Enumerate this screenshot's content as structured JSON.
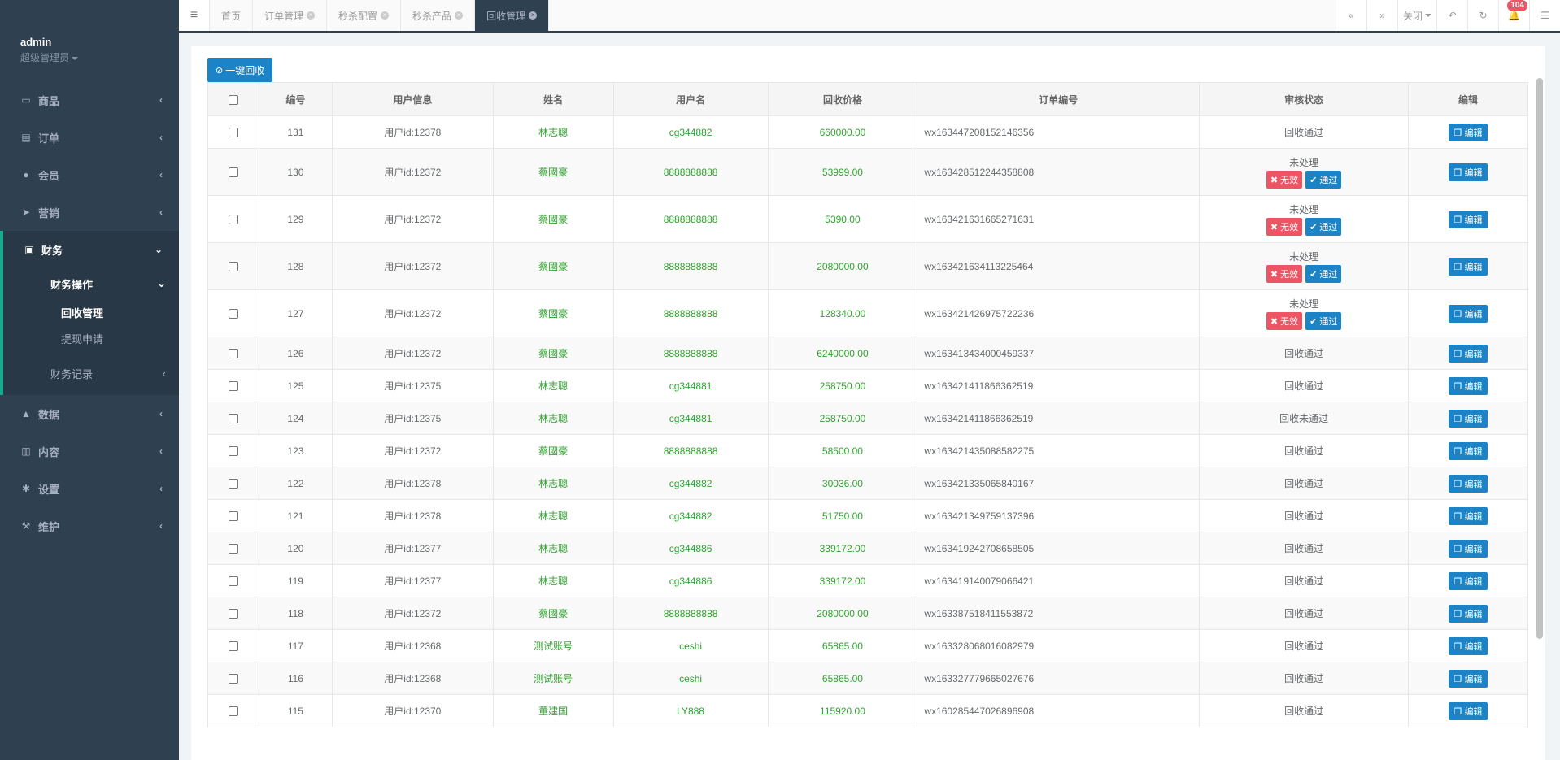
{
  "user": {
    "name": "admin",
    "role": "超级管理员"
  },
  "nav": [
    {
      "label": "商品",
      "icon": "monitor-icon"
    },
    {
      "label": "订单",
      "icon": "document-icon"
    },
    {
      "label": "会员",
      "icon": "user-icon"
    },
    {
      "label": "营销",
      "icon": "send-icon"
    }
  ],
  "nav_active": {
    "label": "财务",
    "icon": "money-icon",
    "sub": {
      "label": "财务操作",
      "items": [
        {
          "label": "回收管理"
        },
        {
          "label": "提现申请"
        }
      ]
    },
    "sub2": {
      "label": "财务记录"
    }
  },
  "nav_after": [
    {
      "label": "数据",
      "icon": "chart-icon"
    },
    {
      "label": "内容",
      "icon": "book-icon"
    },
    {
      "label": "设置",
      "icon": "gear-icon"
    },
    {
      "label": "维护",
      "icon": "wrench-icon"
    }
  ],
  "tabs": [
    {
      "label": "首页",
      "closable": false
    },
    {
      "label": "订单管理",
      "closable": true
    },
    {
      "label": "秒杀配置",
      "closable": true
    },
    {
      "label": "秒杀产品",
      "closable": true
    },
    {
      "label": "回收管理",
      "closable": true,
      "active": true
    }
  ],
  "topbar": {
    "close_label": "关闭",
    "notification_count": "104"
  },
  "toolbar": {
    "one_key_label": "一键回收"
  },
  "table": {
    "headers": [
      "编号",
      "用户信息",
      "姓名",
      "用户名",
      "回收价格",
      "订单编号",
      "审核状态",
      "编辑"
    ],
    "edit_label": "编辑",
    "invalid_label": "无效",
    "pass_label": "通过",
    "rows": [
      {
        "id": "131",
        "user_info": "用户id:12378",
        "name": "林志聰",
        "username": "cg344882",
        "price": "660000.00",
        "order_no": "wx163447208152146356",
        "status": "回收通过",
        "pending": false
      },
      {
        "id": "130",
        "user_info": "用户id:12372",
        "name": "蔡國豪",
        "username": "8888888888",
        "price": "53999.00",
        "order_no": "wx163428512244358808",
        "status": "未处理",
        "pending": true
      },
      {
        "id": "129",
        "user_info": "用户id:12372",
        "name": "蔡國豪",
        "username": "8888888888",
        "price": "5390.00",
        "order_no": "wx163421631665271631",
        "status": "未处理",
        "pending": true
      },
      {
        "id": "128",
        "user_info": "用户id:12372",
        "name": "蔡國豪",
        "username": "8888888888",
        "price": "2080000.00",
        "order_no": "wx163421634113225464",
        "status": "未处理",
        "pending": true
      },
      {
        "id": "127",
        "user_info": "用户id:12372",
        "name": "蔡國豪",
        "username": "8888888888",
        "price": "128340.00",
        "order_no": "wx163421426975722236",
        "status": "未处理",
        "pending": true
      },
      {
        "id": "126",
        "user_info": "用户id:12372",
        "name": "蔡國豪",
        "username": "8888888888",
        "price": "6240000.00",
        "order_no": "wx163413434000459337",
        "status": "回收通过",
        "pending": false
      },
      {
        "id": "125",
        "user_info": "用户id:12375",
        "name": "林志聰",
        "username": "cg344881",
        "price": "258750.00",
        "order_no": "wx163421411866362519",
        "status": "回收通过",
        "pending": false
      },
      {
        "id": "124",
        "user_info": "用户id:12375",
        "name": "林志聰",
        "username": "cg344881",
        "price": "258750.00",
        "order_no": "wx163421411866362519",
        "status": "回收未通过",
        "pending": false
      },
      {
        "id": "123",
        "user_info": "用户id:12372",
        "name": "蔡國豪",
        "username": "8888888888",
        "price": "58500.00",
        "order_no": "wx163421435088582275",
        "status": "回收通过",
        "pending": false
      },
      {
        "id": "122",
        "user_info": "用户id:12378",
        "name": "林志聰",
        "username": "cg344882",
        "price": "30036.00",
        "order_no": "wx163421335065840167",
        "status": "回收通过",
        "pending": false
      },
      {
        "id": "121",
        "user_info": "用户id:12378",
        "name": "林志聰",
        "username": "cg344882",
        "price": "51750.00",
        "order_no": "wx163421349759137396",
        "status": "回收通过",
        "pending": false
      },
      {
        "id": "120",
        "user_info": "用户id:12377",
        "name": "林志聰",
        "username": "cg344886",
        "price": "339172.00",
        "order_no": "wx163419242708658505",
        "status": "回收通过",
        "pending": false
      },
      {
        "id": "119",
        "user_info": "用户id:12377",
        "name": "林志聰",
        "username": "cg344886",
        "price": "339172.00",
        "order_no": "wx163419140079066421",
        "status": "回收通过",
        "pending": false
      },
      {
        "id": "118",
        "user_info": "用户id:12372",
        "name": "蔡國豪",
        "username": "8888888888",
        "price": "2080000.00",
        "order_no": "wx163387518411553872",
        "status": "回收通过",
        "pending": false
      },
      {
        "id": "117",
        "user_info": "用户id:12368",
        "name": "测试账号",
        "username": "ceshi",
        "price": "65865.00",
        "order_no": "wx163328068016082979",
        "status": "回收通过",
        "pending": false
      },
      {
        "id": "116",
        "user_info": "用户id:12368",
        "name": "测试账号",
        "username": "ceshi",
        "price": "65865.00",
        "order_no": "wx163327779665027676",
        "status": "回收通过",
        "pending": false
      },
      {
        "id": "115",
        "user_info": "用户id:12370",
        "name": "董建国",
        "username": "LY888",
        "price": "115920.00",
        "order_no": "wx160285447026896908",
        "status": "回收通过",
        "pending": false
      }
    ]
  }
}
